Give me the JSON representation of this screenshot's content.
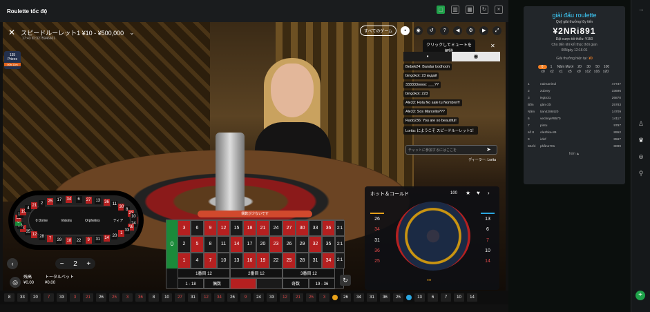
{
  "window": {
    "title": "Roulette tốc độ"
  },
  "game": {
    "name": "スピードルーレット1 ¥10 - ¥500,000",
    "session": "17:43 ID:3275946601",
    "all_games": "すべてのゲーム",
    "tooltip": "クリックしてミュートを解除",
    "badge_top": "135",
    "badge_mid": "Prizes",
    "badge_tag": "00h 11m"
  },
  "chat": {
    "messages": [
      "Bebek24: Bandar bodhooh",
      "bingokot: 23 кидай",
      "333333oooo: ___??",
      "bingokot: 223",
      "Ale33: Hola No sale tu Nombre!!!",
      "Ale33: Sos Marcella???",
      "Rado236: You are so beautiful!",
      "Lorita: にようこそ スピードルーレット1！"
    ],
    "placeholder": "チャットに参加するにはここを",
    "footer": "ディーラー: Lorita"
  },
  "racetrack": {
    "labels": [
      "0 Dome",
      "Voisins",
      "Orphelins",
      "ティア"
    ],
    "numbers": [
      "5",
      "24",
      "16",
      "33",
      "1",
      "20",
      "14",
      "31",
      "9",
      "22",
      "18",
      "29",
      "7",
      "28",
      "12",
      "35",
      "3",
      "26",
      "0",
      "32",
      "15",
      "19",
      "4",
      "21",
      "2",
      "25",
      "17",
      "34",
      "6",
      "27",
      "13",
      "36",
      "11",
      "30",
      "8",
      "23",
      "10"
    ]
  },
  "betting": {
    "banner": "偶数が少ないです",
    "zero": "0",
    "rows": [
      [
        "3",
        "6",
        "9",
        "12",
        "15",
        "18",
        "21",
        "24",
        "27",
        "30",
        "33",
        "36"
      ],
      [
        "2",
        "5",
        "8",
        "11",
        "14",
        "17",
        "20",
        "23",
        "26",
        "29",
        "32",
        "35"
      ],
      [
        "1",
        "4",
        "7",
        "10",
        "13",
        "16",
        "19",
        "22",
        "25",
        "28",
        "31",
        "34"
      ]
    ],
    "colors": [
      [
        "r",
        "b",
        "r",
        "r",
        "b",
        "r",
        "r",
        "b",
        "r",
        "r",
        "b",
        "r"
      ],
      [
        "b",
        "r",
        "b",
        "b",
        "r",
        "b",
        "b",
        "r",
        "b",
        "b",
        "r",
        "b"
      ],
      [
        "r",
        "b",
        "r",
        "b",
        "b",
        "r",
        "r",
        "b",
        "r",
        "b",
        "b",
        "r"
      ]
    ],
    "col_labels": [
      "2:1",
      "2:1",
      "2:1"
    ],
    "dozens": [
      "1番目 12",
      "2番目 12",
      "3番目 12"
    ],
    "outside": [
      "1 - 18",
      "偶数",
      "",
      "",
      "奇数",
      "19 - 36"
    ]
  },
  "stepper": {
    "minus": "−",
    "value": "2",
    "plus": "+"
  },
  "balance": {
    "label": "残高",
    "value": "¥0.00",
    "bet_label": "トータルベット",
    "bet_value": "¥0.00"
  },
  "hot_cold": {
    "title": "ホット＆コールド",
    "count": "100",
    "hot": [
      "26",
      "34",
      "31",
      "36",
      "25"
    ],
    "cold": [
      "13",
      "6",
      "7",
      "10",
      "14"
    ],
    "hot_colors": [
      "b",
      "r",
      "b",
      "r",
      "r"
    ],
    "cold_colors": [
      "b",
      "b",
      "r",
      "b",
      "r"
    ]
  },
  "history": [
    {
      "n": "8",
      "c": "b"
    },
    {
      "n": "33",
      "c": "b"
    },
    {
      "n": "20",
      "c": "b"
    },
    {
      "n": "7",
      "c": "r"
    },
    {
      "n": "33",
      "c": "b"
    },
    {
      "n": "3",
      "c": "r"
    },
    {
      "n": "21",
      "c": "r"
    },
    {
      "n": "26",
      "c": "b"
    },
    {
      "n": "25",
      "c": "r"
    },
    {
      "n": "3",
      "c": "r"
    },
    {
      "n": "36",
      "c": "r"
    },
    {
      "n": "8",
      "c": "b"
    },
    {
      "n": "10",
      "c": "b"
    },
    {
      "n": "27",
      "c": "r"
    },
    {
      "n": "31",
      "c": "b"
    },
    {
      "n": "12",
      "c": "r"
    },
    {
      "n": "34",
      "c": "r"
    },
    {
      "n": "26",
      "c": "b"
    },
    {
      "n": "9",
      "c": "r"
    },
    {
      "n": "24",
      "c": "b"
    },
    {
      "n": "33",
      "c": "b"
    },
    {
      "n": "12",
      "c": "r"
    },
    {
      "n": "21",
      "c": "r"
    },
    {
      "n": "25",
      "c": "r"
    },
    {
      "n": "3",
      "c": "r"
    }
  ],
  "history_hot": [
    "26",
    "34",
    "31",
    "36",
    "25"
  ],
  "history_cold": [
    "13",
    "6",
    "7",
    "10",
    "14"
  ],
  "tournament": {
    "title": "giải đấu roulette",
    "prize_label": "Quỹ giải thưởng lũy tiến",
    "prize_value": "¥2NRi891",
    "min_bet": "Đặt cược tối thiểu: ¥150",
    "countdown_label": "Cho đến khi kết thúc thời gian",
    "countdown": "00Ngày  12:16:01",
    "current_prize_label": "Giải thưởng hiện tại:",
    "current_prize": "¥0",
    "multipliers": [
      "0",
      "1",
      "Năm Mươi",
      "20",
      "30",
      "50",
      "100"
    ],
    "mult_sub": [
      "x0",
      "x2",
      "x1",
      "x5",
      "x9",
      "x12",
      "x16",
      "x20"
    ],
    "leaderboard": [
      [
        "1",
        "naimaninul",
        "47737"
      ],
      [
        "2",
        "zubrey",
        "33696"
      ],
      [
        "3",
        "Ngtn31",
        "26870"
      ],
      [
        "Bốn",
        "gàn côt",
        "25783"
      ],
      [
        "Năm",
        "tian4288420",
        "14709"
      ],
      [
        "6",
        "vechnyi#9570",
        "14117"
      ],
      [
        "7",
        "pintu",
        "9797"
      ],
      [
        "số 8",
        "olezhka-89",
        "8952"
      ],
      [
        "9",
        "ivlef",
        "8567"
      ],
      [
        "Mười",
        "phần1701",
        "8099"
      ]
    ],
    "more": "hơn ▲"
  }
}
